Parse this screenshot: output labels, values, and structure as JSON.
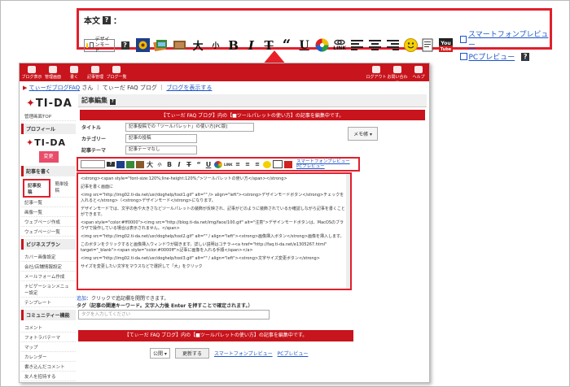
{
  "callout": {
    "label": "本文",
    "help_mark": "?",
    "design_button_label": "デザインモード",
    "tool_labels": {
      "bold": "B",
      "italic": "I",
      "strike": "T",
      "quote": "“",
      "underline": "U",
      "large": "大",
      "small": "小",
      "link": "LINK"
    },
    "smartphone_preview": "スマートフォンプレビュー",
    "pc_preview": "PCプレビュー"
  },
  "app": {
    "topbar_items": [
      "ブログ表示",
      "管理画面",
      "書く",
      "記事管理",
      "ブログ一覧"
    ],
    "topbar_right": [
      "ログアウト",
      "お問い合わせ",
      "ヘルプ"
    ],
    "breadcrumb": {
      "blog": "てぃーだブログFAQ",
      "suffix": "さん",
      "sep": "｜",
      "page": "てぃーだ FAQ ブログ",
      "view_link": "ブログを表示する"
    },
    "sidebar": {
      "logo": "TI-DA",
      "top_link": "管理画面TOP",
      "profile_head": "プロフィール",
      "change_btn": "変更",
      "write_head": "記事を書く",
      "write_links": [
        "記事投稿",
        "簡単投稿",
        "記事一覧",
        "画像一覧",
        "ウェブページ作成",
        "ウェブページ一覧"
      ],
      "biz_head": "ビジネスプラン",
      "biz_links": [
        "カバー画像設定",
        "会社/店舗情報設定",
        "メールフォーム作成",
        "ナビゲーションメニュー設定",
        "テンプレート"
      ],
      "comm_head": "コミュニティー機能",
      "comm_links": [
        "コメント",
        "フォトラバテーマ",
        "マップ",
        "カレンダー",
        "書き込んだコメント",
        "友人を招待する"
      ]
    },
    "section_title": "記事編集",
    "banner_top": "【てぃーだ FAQ ブログ】内の【■ツールパレットの使い方】の記事を編集中です。",
    "form": {
      "title_label": "タイトル",
      "title_value": "記事投稿での「ツールパレット」の使い方[PC版]",
      "category_label": "カテゴリー",
      "category_value": "記事の投稿",
      "theme_label": "記事テーマ",
      "theme_value": "記事テーマなし",
      "memo_button": "メモ帳"
    },
    "editor_lines": [
      "<strong><span style=\"font-size:120%;line-height:120%;\">ツールパレットの使い方</span></strong>",
      "記事を書く画面に",
      "<img src=\"http://img02.ti-da.net/usr/doghelp/tool1.gif\" alt=\"\" /> align=\"left\"><strong>デザインモードボタン</strong>チェックを入れると</strong>（<strong>デザインモード</strong>になります。",
      "デザインモードでは、文字の色や大きさなどツールパレットの装飾が反映され、記事がどのように装飾されているか確認しながら記事を書くことができます。",
      "<span style=\"color:#ff0000\"><img src=\"http://blog.ti-da.net/img/face/100.gif\" alt=\"注意\">デザインモードボタンは、MacOSのブラウザで操作している場合は表示されません。</span>",
      "<img src=\"http://img02.ti-da.net/usr/doghelp/tool2.gif\" alt=\"\" / align=\"left\"><strong>画像挿入ボタン</strong>画像を挿入します。",
      "このボタンをクリックすると画像挿入ウィンドウが開きます。詳しい説明はコチラ→<a href=\"http://faq.ti-da.net/e1305267.html\" target=\"_blank\"><span style=\"color:#0000ff\">記事に画像を入れる手順</span></a>",
      "<img src=\"http://img02.ti-da.net/usr/doghelp/tool3.gif\" alt=\"\" / align=\"left\"><strong>文字サイズ変更ボタン</strong>",
      "サイズを変更したい文字をマウスなどで選択して「大」をクリック"
    ],
    "add_link": "追加",
    "add_hint": "：クリックで追記欄を開閉できます。",
    "tag_label": "タグ（記事の関連キーワード。文字入力後 Enter を押すことで確定されます。）",
    "tag_placeholder": "タグを入力してください",
    "banner_bottom": "【てぃーだ FAQ ブログ】内の【■ツールパレットの使い方】の記事を編集中です。",
    "publish_select": "公開",
    "update_button": "更新する",
    "sp_preview": "スマートフォンプレビュー",
    "pc_preview": "PCプレビュー"
  },
  "colors": {
    "accent_red": "#c8141c",
    "highlight_red": "#e0202c",
    "link_blue": "#1b54c9"
  }
}
